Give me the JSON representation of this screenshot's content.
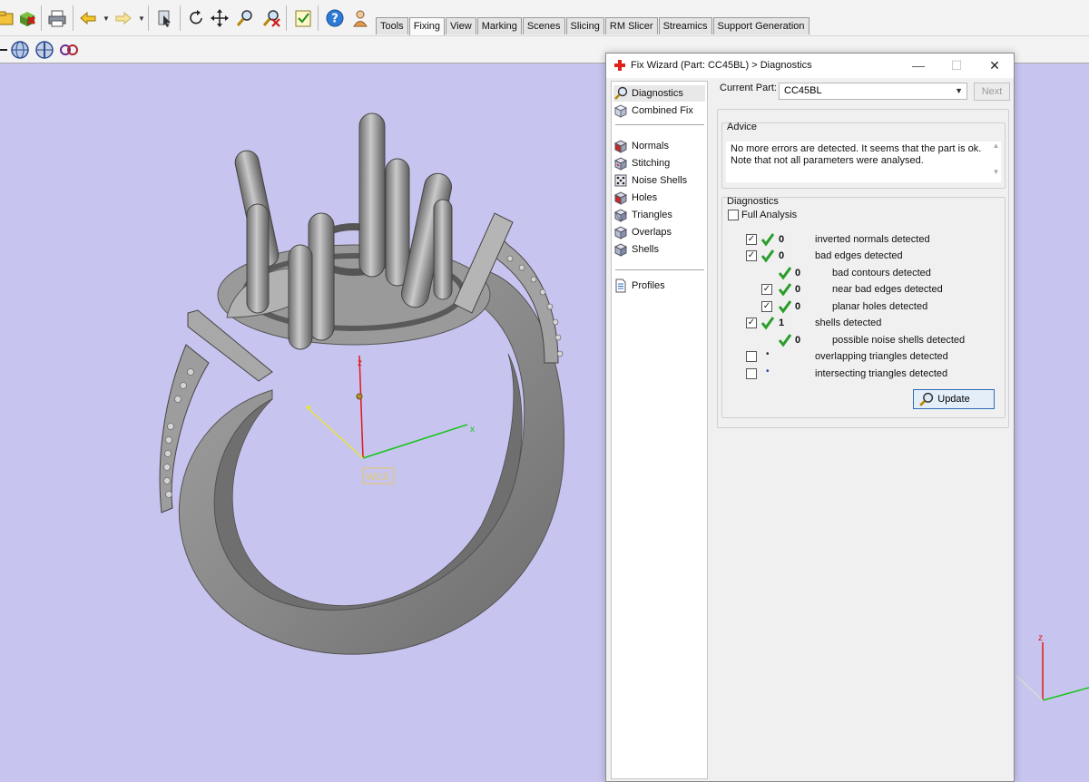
{
  "app": {
    "tabs": [
      {
        "label": "Tools"
      },
      {
        "label": "Fixing",
        "active": true
      },
      {
        "label": "View"
      },
      {
        "label": "Marking"
      },
      {
        "label": "Scenes"
      },
      {
        "label": "Slicing"
      },
      {
        "label": "RM Slicer"
      },
      {
        "label": "Streamics"
      },
      {
        "label": "Support Generation"
      }
    ]
  },
  "viewport": {
    "axis_labels": {
      "z": "z",
      "x": "x"
    },
    "wcs_label": "WCS",
    "corner_axis_label": "z",
    "background_color": "#c7c5ef",
    "model_color": "#8f8f8f"
  },
  "dialog": {
    "title": "Fix Wizard (Part: CC45BL) > Diagnostics",
    "controls": {
      "minimize": "—",
      "maximize": "☐",
      "close": "✕"
    },
    "nav": [
      {
        "label": "Diagnostics",
        "icon": "magnifier-icon",
        "selected": true
      },
      {
        "label": "Combined Fix",
        "icon": "cube-outline-icon"
      },
      {
        "label": "Normals",
        "icon": "cube-red-icon"
      },
      {
        "label": "Stitching",
        "icon": "cube-stitch-icon"
      },
      {
        "label": "Noise Shells",
        "icon": "dice-icon"
      },
      {
        "label": "Holes",
        "icon": "cube-red-icon"
      },
      {
        "label": "Triangles",
        "icon": "cube-triangles-icon"
      },
      {
        "label": "Overlaps",
        "icon": "cube-overlap-icon"
      },
      {
        "label": "Shells",
        "icon": "cube-shells-icon"
      },
      {
        "label": "Profiles",
        "icon": "document-icon"
      }
    ],
    "current_part": {
      "label": "Current Part:",
      "value": "CC45BL"
    },
    "next_label": "Next",
    "advice": {
      "title": "Advice",
      "text": "No more errors are detected. It seems that the part is ok. Note that not all parameters were analysed."
    },
    "diagnostics": {
      "title": "Diagnostics",
      "full_analysis": {
        "label": "Full Analysis",
        "checked": false
      },
      "rows": [
        {
          "label": "inverted normals detected",
          "count": "0",
          "checked": true,
          "status": "ok",
          "level": 0
        },
        {
          "label": "bad edges detected",
          "count": "0",
          "checked": true,
          "status": "ok",
          "level": 0
        },
        {
          "label": "bad contours detected",
          "count": "0",
          "checked": null,
          "status": "ok",
          "level": 1
        },
        {
          "label": "near bad edges detected",
          "count": "0",
          "checked": true,
          "status": "ok",
          "level": 1
        },
        {
          "label": "planar holes detected",
          "count": "0",
          "checked": true,
          "status": "ok",
          "level": 1
        },
        {
          "label": "shells detected",
          "count": "1",
          "checked": true,
          "status": "ok",
          "level": 0
        },
        {
          "label": "possible noise shells detected",
          "count": "0",
          "checked": null,
          "status": "ok",
          "level": 1
        },
        {
          "label": "overlapping triangles detected",
          "count": "",
          "checked": false,
          "status": "none",
          "level": 0
        },
        {
          "label": "intersecting triangles detected",
          "count": "",
          "checked": false,
          "status": "none",
          "level": 0
        }
      ],
      "update_label": "Update"
    }
  }
}
